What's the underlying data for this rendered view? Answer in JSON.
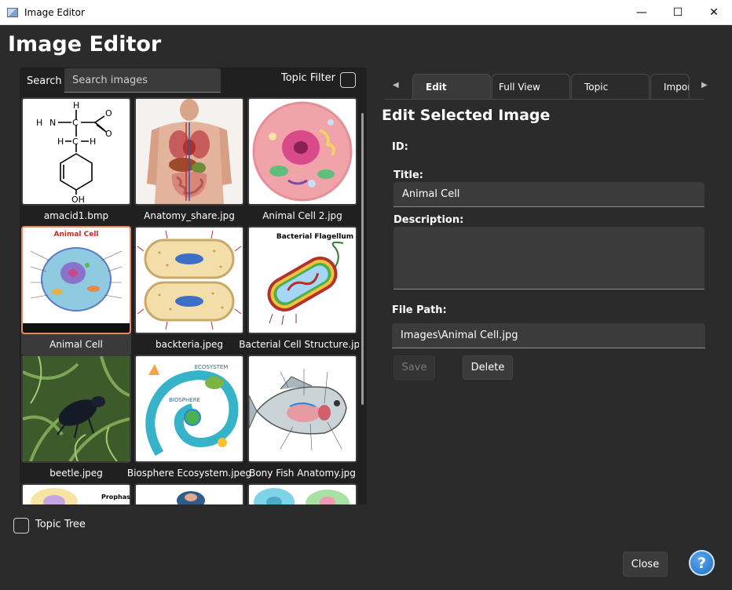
{
  "window": {
    "title": "Image Editor",
    "minimize_glyph": "—",
    "maximize_glyph": "☐",
    "close_glyph": "✕"
  },
  "app_title": "Image Editor",
  "left": {
    "search_label": "Search",
    "search_placeholder": "Search images",
    "search_value": "",
    "topic_filter_label": "Topic Filter",
    "topic_tree_label": "Topic Tree",
    "images": [
      {
        "name": "amacid1.bmp",
        "icon": "amino-acid-structure"
      },
      {
        "name": "Anatomy_share.jpg",
        "icon": "human-anatomy"
      },
      {
        "name": "Animal Cell 2.jpg",
        "icon": "animal-cell-oval"
      },
      {
        "name": "Animal Cell",
        "icon": "animal-cell-diagram",
        "selected": true
      },
      {
        "name": "backteria.jpeg",
        "icon": "bacteria-division"
      },
      {
        "name": "Bacterial Cell Structure.jpg",
        "icon": "bacterial-flagellum"
      },
      {
        "name": "beetle.jpeg",
        "icon": "beetle-photo"
      },
      {
        "name": "Biosphere Ecosystem.jpeg",
        "icon": "biosphere-spiral"
      },
      {
        "name": "Bony Fish Anatomy.jpg",
        "icon": "fish-anatomy"
      },
      {
        "name": "",
        "icon": "prophase-partial"
      },
      {
        "name": "",
        "icon": "partial-image"
      },
      {
        "name": "",
        "icon": "partial-cells"
      }
    ],
    "thumb_text": {
      "animal_cell_heading": "Animal Cell",
      "flagellum_heading": "Bacterial Flagellum",
      "prophase_heading": "Prophase",
      "ecosystem_heading": "ECOSYSTEM",
      "biosphere_heading": "BIOSPHERE",
      "oh_label": "OH",
      "h_label": "H",
      "n_label": "N",
      "c_label": "C",
      "o_label": "O"
    }
  },
  "tabs": [
    {
      "label": "Edit",
      "active": true
    },
    {
      "label": "Full View"
    },
    {
      "label": "Topic"
    },
    {
      "label": "Import"
    }
  ],
  "tab_prev_glyph": "◀",
  "tab_next_glyph": "▶",
  "edit": {
    "heading": "Edit Selected Image",
    "id_label": "ID:",
    "title_label": "Title:",
    "title_value": "Animal Cell",
    "description_label": "Description:",
    "description_value": "",
    "file_path_label": "File Path:",
    "file_path_value": "Images\\Animal Cell.jpg",
    "save_label": "Save",
    "delete_label": "Delete"
  },
  "footer": {
    "close_label": "Close",
    "help_glyph": "?"
  },
  "colors": {
    "background": "#2b2b2b",
    "panel": "#202020",
    "field": "#3b3b3b",
    "selected_border": "#e0896b",
    "help_blue": "#1f6fc2"
  }
}
